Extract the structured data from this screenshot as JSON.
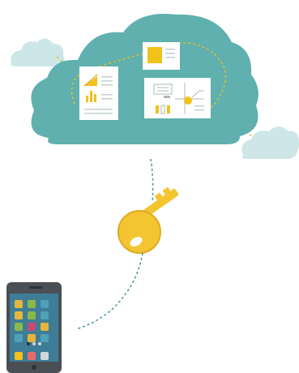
{
  "illustration": {
    "colors": {
      "cloud_main": "#5fb0ae",
      "cloud_small": "#cde6e7",
      "document": "#ffffff",
      "accent_yellow": "#f2c21b",
      "key_gold": "#f3c531",
      "key_shadow": "#e0a91f",
      "dashed_line": "#3e9a9a",
      "phone_body": "#4a4f55",
      "phone_screen": "#3f7d97"
    },
    "icons": [
      "cloud-icon",
      "document-icon",
      "key-icon",
      "smartphone-icon"
    ],
    "phone_app_colors": [
      "#e7b53c",
      "#8bb84a",
      "#4ea1b8",
      "#e7b53c",
      "#8bb84a",
      "#4ea1b8",
      "#8bb84a",
      "#c74a77",
      "#e7b53c",
      "#4ea1b8",
      "#e7b53c",
      "#4ea1b8",
      "#f2c21b",
      "#e86b6b",
      "#cfd8dc"
    ]
  }
}
